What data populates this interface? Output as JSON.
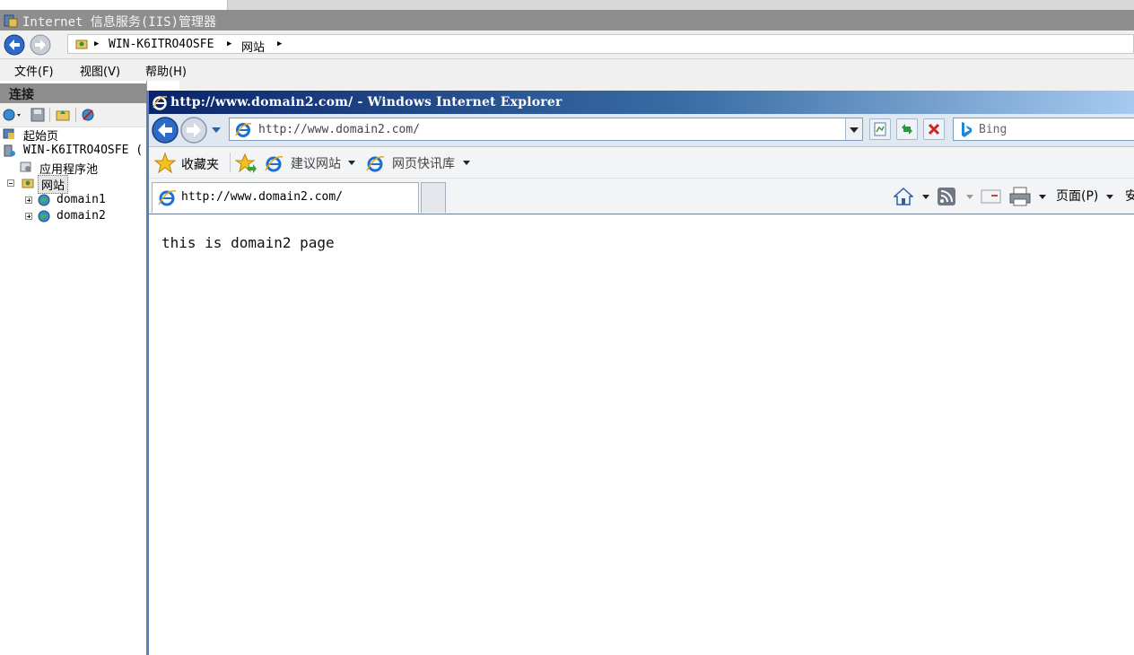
{
  "iis": {
    "title": "Internet 信息服务(IIS)管理器",
    "breadcrumb": [
      "WIN-K6ITRO4OSFE",
      "网站"
    ],
    "menu": [
      "文件(F)",
      "视图(V)",
      "帮助(H)"
    ],
    "connections_title": "连接",
    "tree": {
      "start_page": "起始页",
      "server": "WIN-K6ITRO4OSFE (",
      "app_pools": "应用程序池",
      "sites": "网站",
      "site1": "domain1",
      "site2": "domain2"
    }
  },
  "ie": {
    "title": "http://www.domain2.com/ - Windows Internet Explorer",
    "url": "http://www.domain2.com/",
    "search_placeholder": "Bing",
    "favorites_label": "收藏夹",
    "suggested_sites": "建议网站",
    "web_slice_gallery": "网页快讯库",
    "tab_title": "http://www.domain2.com/",
    "page_menu": "页面(P)",
    "safety_menu_partial": "安",
    "page_content": "this is domain2 page"
  },
  "colors": {
    "ie_title_gradient_start": "#0a246a",
    "ie_title_gradient_end": "#a6caf0",
    "iis_title_bg": "#8e8e8e",
    "stop_red": "#d42020",
    "refresh_green": "#2a9a3a"
  },
  "icons": [
    "back-arrow-icon",
    "forward-arrow-icon",
    "ie-logo-icon",
    "folder-icon",
    "home-icon",
    "rss-icon",
    "mail-icon",
    "print-icon",
    "star-icon",
    "bing-icon",
    "stop-icon",
    "refresh-icon",
    "compat-view-icon",
    "globe-icon",
    "server-icon"
  ]
}
